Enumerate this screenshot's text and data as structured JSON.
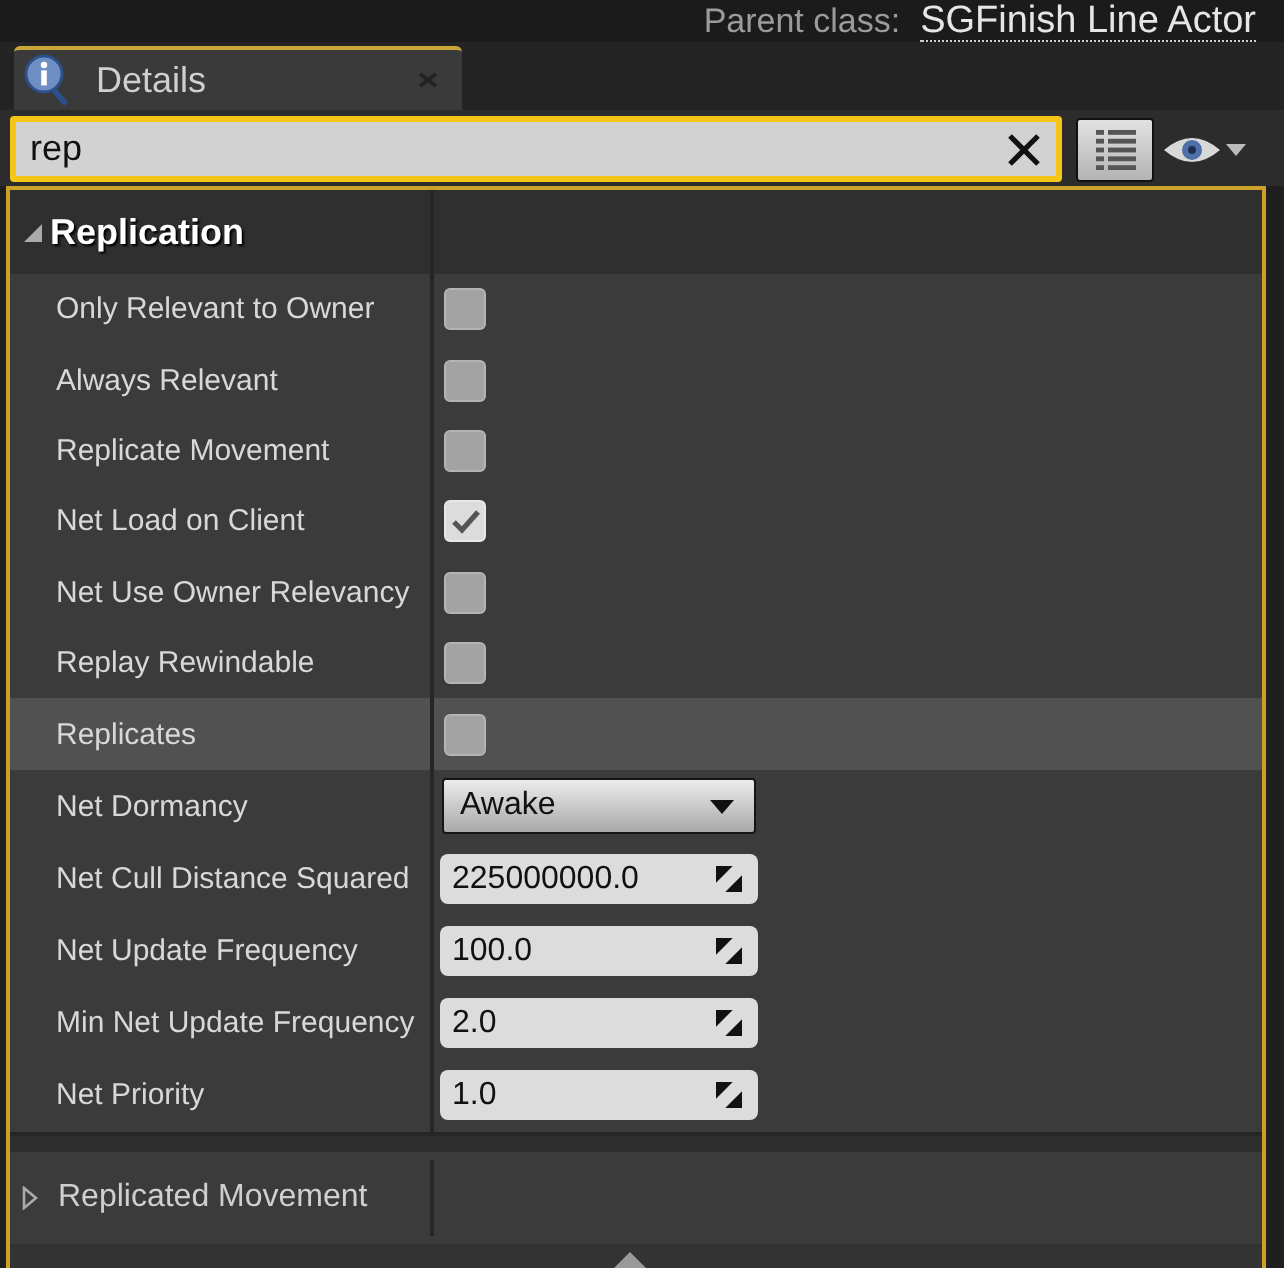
{
  "parent_class": {
    "label": "Parent class:",
    "value": "SGFinish Line Actor"
  },
  "tabs": [
    {
      "label": "Details",
      "selected": true
    }
  ],
  "search": {
    "value": "rep"
  },
  "sections": [
    {
      "kind": "category",
      "title": "Replication",
      "expanded": true,
      "properties": [
        {
          "label": "Only Relevant to Owner",
          "kind": "checkbox",
          "checked": false,
          "highlighted": false
        },
        {
          "label": "Always Relevant",
          "kind": "checkbox",
          "checked": false,
          "highlighted": false
        },
        {
          "label": "Replicate Movement",
          "kind": "checkbox",
          "checked": false,
          "highlighted": false
        },
        {
          "label": "Net Load on Client",
          "kind": "checkbox",
          "checked": true,
          "highlighted": false
        },
        {
          "label": "Net Use Owner Relevancy",
          "kind": "checkbox",
          "checked": false,
          "highlighted": false
        },
        {
          "label": "Replay Rewindable",
          "kind": "checkbox",
          "checked": false,
          "highlighted": false
        },
        {
          "label": "Replicates",
          "kind": "checkbox",
          "checked": false,
          "highlighted": true
        },
        {
          "label": "Net Dormancy",
          "kind": "dropdown",
          "value": "Awake",
          "highlighted": false
        },
        {
          "label": "Net Cull Distance Squared",
          "kind": "number",
          "value": "225000000.0",
          "highlighted": false
        },
        {
          "label": "Net Update Frequency",
          "kind": "number",
          "value": "100.0",
          "highlighted": false
        },
        {
          "label": "Min Net Update Frequency",
          "kind": "number",
          "value": "2.0",
          "highlighted": false
        },
        {
          "label": "Net Priority",
          "kind": "number",
          "value": "1.0",
          "highlighted": false
        }
      ]
    },
    {
      "kind": "struct",
      "title": "Replicated Movement",
      "expanded": false
    }
  ]
}
